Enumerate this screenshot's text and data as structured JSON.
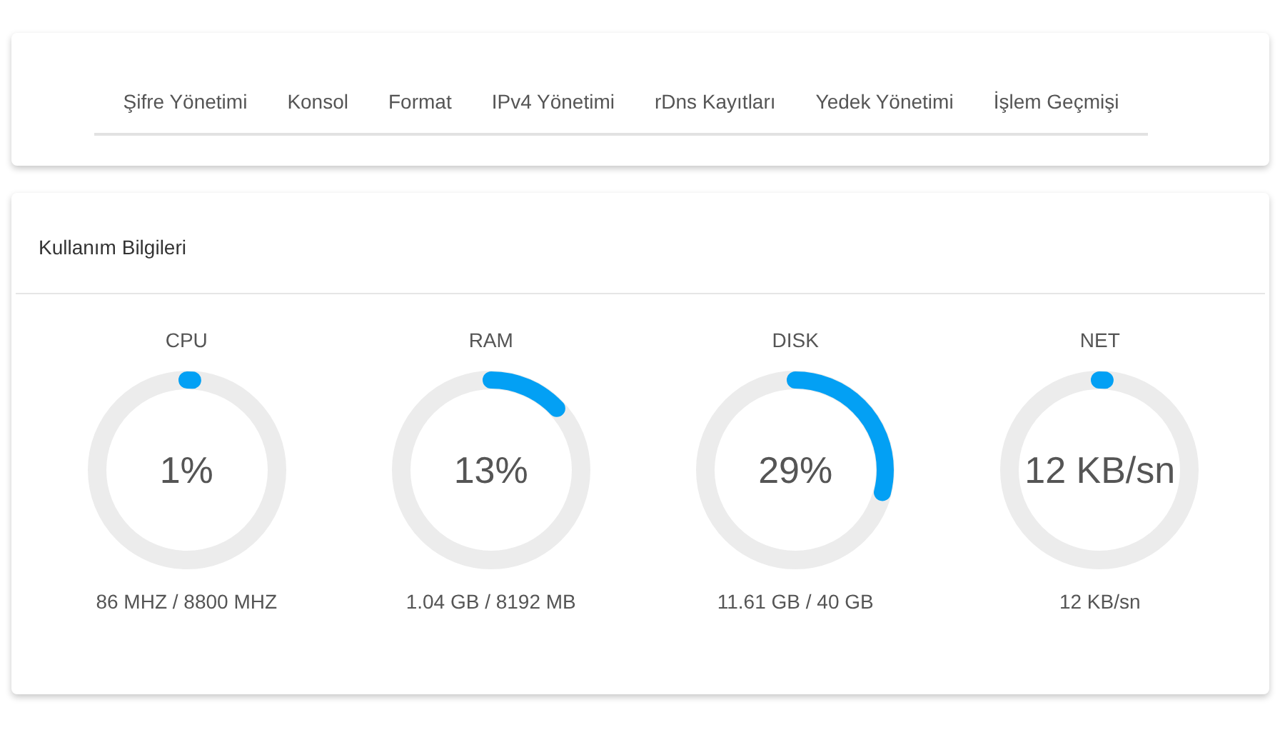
{
  "tabs": [
    {
      "label": "Şifre Yönetimi"
    },
    {
      "label": "Konsol"
    },
    {
      "label": "Format"
    },
    {
      "label": "IPv4 Yönetimi"
    },
    {
      "label": "rDns Kayıtları"
    },
    {
      "label": "Yedek Yönetimi"
    },
    {
      "label": "İşlem Geçmişi"
    }
  ],
  "usage": {
    "title": "Kullanım Bilgileri",
    "gauges": [
      {
        "name": "CPU",
        "value": "1%",
        "level": 0.01,
        "detail": "86 MHZ / 8800 MHZ"
      },
      {
        "name": "RAM",
        "value": "13%",
        "level": 0.13,
        "detail": "1.04 GB / 8192 MB"
      },
      {
        "name": "DISK",
        "value": "29%",
        "level": 0.29,
        "detail": "11.61 GB / 40 GB"
      },
      {
        "name": "NET",
        "value": "12 KB/sn",
        "level": 0.01,
        "detail": "12 KB/sn"
      }
    ]
  }
}
